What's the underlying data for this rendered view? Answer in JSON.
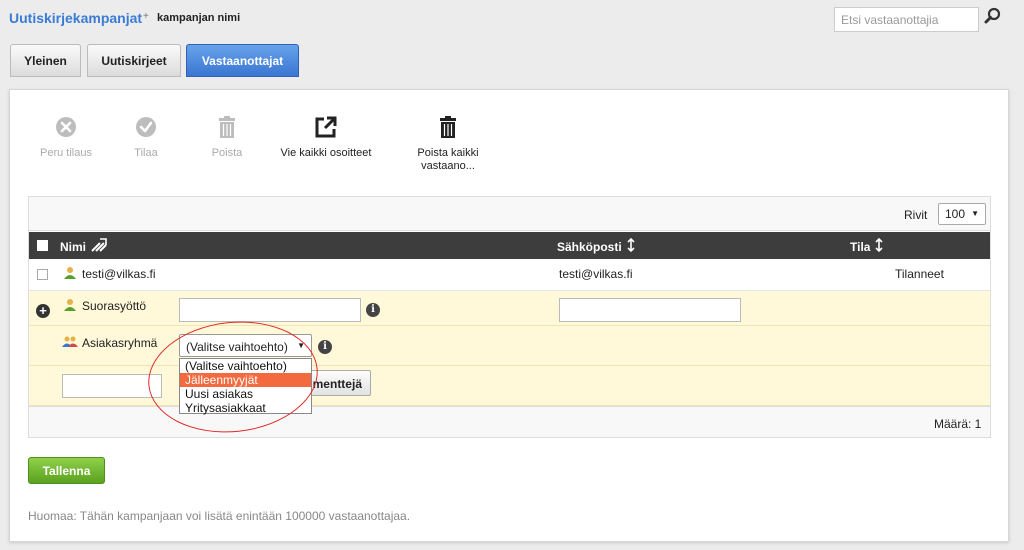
{
  "breadcrumb": {
    "main": "Uutiskirjekampanjat",
    "separator": "+",
    "sub": "kampanjan nimi"
  },
  "search": {
    "placeholder": "Etsi vastaanottajia"
  },
  "tabs": [
    {
      "label": "Yleinen",
      "active": false
    },
    {
      "label": "Uutiskirjeet",
      "active": false
    },
    {
      "label": "Vastaanottajat",
      "active": true
    }
  ],
  "toolbar": [
    {
      "label": "Peru tilaus",
      "icon": "cancel-icon",
      "enabled": false
    },
    {
      "label": "Tilaa",
      "icon": "check-icon",
      "enabled": false
    },
    {
      "label": "Poista",
      "icon": "trash-icon",
      "enabled": false
    },
    {
      "label": "Vie kaikki osoitteet",
      "icon": "export-icon",
      "enabled": true
    },
    {
      "label_line1": "Poista kaikki",
      "label_line2": "vastaano...",
      "icon": "trash-icon",
      "enabled": true
    }
  ],
  "grid": {
    "rows_label": "Rivit",
    "rows_value": "100",
    "columns": {
      "name": "Nimi",
      "email": "Sähköposti",
      "status": "Tila"
    },
    "rows": [
      {
        "name": "testi@vilkas.fi",
        "email": "testi@vilkas.fi",
        "status": "Tilanneet"
      }
    ],
    "direct_input_label": "Suorasyöttö",
    "customer_group_label": "Asiakasryhmä",
    "select_value": "(Valitse vaihtoehto)",
    "select_options": [
      "(Valitse vaihtoehto)",
      "Jälleenmyyjät",
      "Uusi asiakas",
      "Yritysasiakkaat"
    ],
    "highlighted_option_index": 1,
    "segment_button_partial": "menttejä",
    "count_label": "Määrä: 1"
  },
  "save_label": "Tallenna",
  "note": "Huomaa: Tähän kampanjaan voi lisätä enintään 100000 vastaanottajaa.",
  "colors": {
    "accent": "#3a7bd5",
    "save": "#6ab82b",
    "highlight": "#f26a3e",
    "annotation": "#e02a2a"
  }
}
